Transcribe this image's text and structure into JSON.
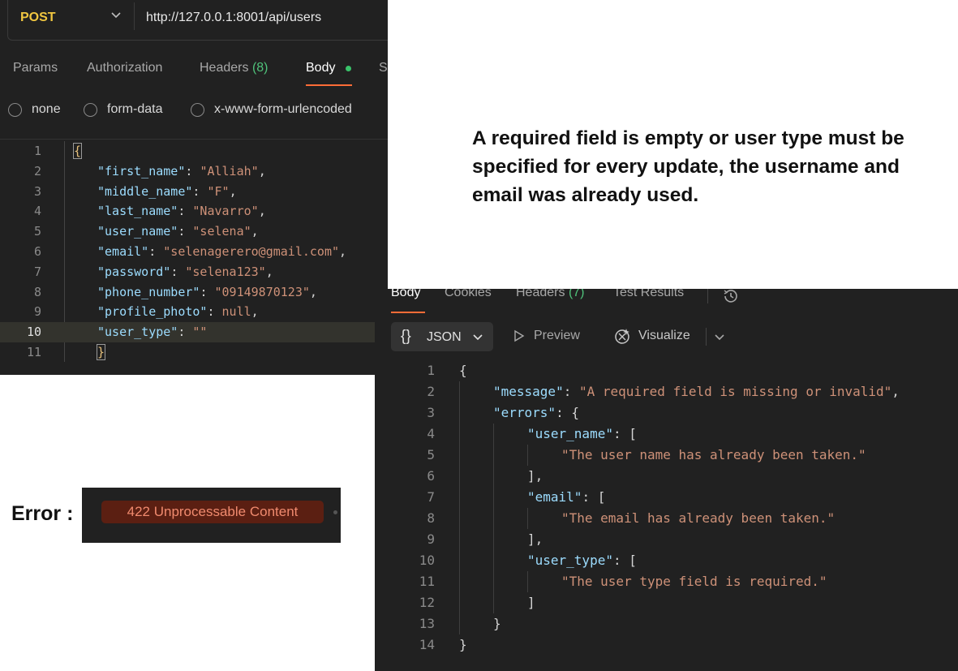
{
  "request": {
    "method": "POST",
    "url": "http://127.0.0.1:8001/api/users",
    "tabs": [
      {
        "label": "Params",
        "count": ""
      },
      {
        "label": "Authorization",
        "count": ""
      },
      {
        "label": "Headers",
        "count": "(8)"
      },
      {
        "label": "Body",
        "count": ""
      },
      {
        "label": "S",
        "count": ""
      }
    ],
    "body_types": [
      "none",
      "form-data",
      "x-www-form-urlencoded"
    ],
    "code_lines": [
      {
        "n": "1",
        "text": "{"
      },
      {
        "n": "2",
        "key": "\"first_name\"",
        "value": "\"Alliah\"",
        "tail": ","
      },
      {
        "n": "3",
        "key": "\"middle_name\"",
        "value": "\"F\"",
        "tail": ","
      },
      {
        "n": "4",
        "key": "\"last_name\"",
        "value": "\"Navarro\"",
        "tail": ","
      },
      {
        "n": "5",
        "key": "\"user_name\"",
        "value": "\"selena\"",
        "tail": ","
      },
      {
        "n": "6",
        "key": "\"email\"",
        "value": "\"selenagerero@gmail.com\"",
        "tail": ","
      },
      {
        "n": "7",
        "key": "\"password\"",
        "value": "\"selena123\"",
        "tail": ","
      },
      {
        "n": "8",
        "key": "\"phone_number\"",
        "value": "\"09149870123\"",
        "tail": ","
      },
      {
        "n": "9",
        "key": "\"profile_photo\"",
        "value": "null",
        "tail": ","
      },
      {
        "n": "10",
        "key": "\"user_type\"",
        "value": "\"\"",
        "tail": ""
      },
      {
        "n": "11",
        "text": "}"
      }
    ]
  },
  "note": "A  required field is empty or user type must be specified for every update, the username and email was already used.",
  "error": {
    "label": "Error :",
    "status": "422 Unprocessable Content"
  },
  "response": {
    "tabs": [
      {
        "label": "Body",
        "count": ""
      },
      {
        "label": "Cookies",
        "count": ""
      },
      {
        "label": "Headers",
        "count": "(7)"
      },
      {
        "label": "Test Results",
        "count": ""
      }
    ],
    "format_braces": "{}",
    "format": "JSON",
    "preview_label": "Preview",
    "visualize_label": "Visualize",
    "code_lines": [
      {
        "n": "1",
        "indent": 0,
        "parts": [
          [
            "p",
            "{"
          ]
        ]
      },
      {
        "n": "2",
        "indent": 1,
        "parts": [
          [
            "k",
            "\"message\""
          ],
          [
            "p",
            ": "
          ],
          [
            "s",
            "\"A required field is missing or invalid\""
          ],
          [
            "p",
            ","
          ]
        ]
      },
      {
        "n": "3",
        "indent": 1,
        "parts": [
          [
            "k",
            "\"errors\""
          ],
          [
            "p",
            ": {"
          ]
        ]
      },
      {
        "n": "4",
        "indent": 2,
        "parts": [
          [
            "k",
            "\"user_name\""
          ],
          [
            "p",
            ": ["
          ]
        ]
      },
      {
        "n": "5",
        "indent": 3,
        "parts": [
          [
            "s",
            "\"The user name has already been taken.\""
          ]
        ]
      },
      {
        "n": "6",
        "indent": 2,
        "parts": [
          [
            "p",
            "],"
          ]
        ]
      },
      {
        "n": "7",
        "indent": 2,
        "parts": [
          [
            "k",
            "\"email\""
          ],
          [
            "p",
            ": ["
          ]
        ]
      },
      {
        "n": "8",
        "indent": 3,
        "parts": [
          [
            "s",
            "\"The email has already been taken.\""
          ]
        ]
      },
      {
        "n": "9",
        "indent": 2,
        "parts": [
          [
            "p",
            "],"
          ]
        ]
      },
      {
        "n": "10",
        "indent": 2,
        "parts": [
          [
            "k",
            "\"user_type\""
          ],
          [
            "p",
            ": ["
          ]
        ]
      },
      {
        "n": "11",
        "indent": 3,
        "parts": [
          [
            "s",
            "\"The user type field is required.\""
          ]
        ]
      },
      {
        "n": "12",
        "indent": 2,
        "parts": [
          [
            "p",
            "]"
          ]
        ]
      },
      {
        "n": "13",
        "indent": 1,
        "parts": [
          [
            "p",
            "}"
          ]
        ]
      },
      {
        "n": "14",
        "indent": 0,
        "parts": [
          [
            "p",
            "}"
          ]
        ]
      }
    ]
  },
  "colors": {
    "panel_bg": "#212121",
    "accent_orange": "#ff6c37",
    "method_yellow": "#f0c640",
    "count_green": "#4fc17a",
    "json_key": "#9cdcfe",
    "json_string": "#ce9178"
  },
  "icons": [
    "chevron-down-icon",
    "history-icon",
    "play-icon",
    "visualize-icon"
  ]
}
